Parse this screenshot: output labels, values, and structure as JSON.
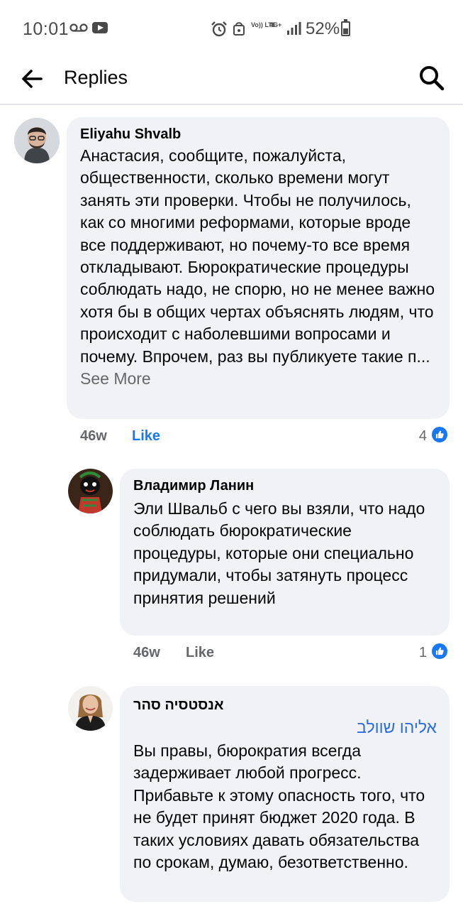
{
  "status_bar": {
    "time": "10:01",
    "battery": "52%",
    "network_volte": "Vo)) LTE",
    "network_4g": "4G+"
  },
  "header": {
    "title": "Replies",
    "back_icon": "back-arrow-icon",
    "search_icon": "search-icon"
  },
  "colors": {
    "bubble": "#f0f2f5",
    "like_blue": "#1877f2",
    "meta_gray": "#65676b"
  },
  "comments": [
    {
      "author": "Eliyahu Shvalb",
      "text": "Анастасия, сообщите, пожалуйста, общественности, сколько времени могут занять эти проверки. Чтобы не получилось, как со многими реформами, которые вроде все поддерживают, но почему-то все время откладывают. Бюрократические процедуры соблюдать надо, не спорю, но не менее важно хотя бы в общих чертах объяснять людям, что происходит с наболевшими вопросами и почему. Впрочем, раз вы публикуете такие п...",
      "see_more": "See More",
      "time": "46w",
      "like_label": "Like",
      "like_count": "4"
    },
    {
      "author": "Владимир Ланин",
      "text": "Эли Швальб  с чего вы взяли, что надо соблюдать бюрократические процедуры, которые они специально придумали, чтобы затянуть процесс принятия решений",
      "time": "46w",
      "like_label": "Like",
      "like_count": "1"
    },
    {
      "author": "אנסטסיה סהר",
      "mention": "אליהו שוולב",
      "text": "Вы правы, бюрократия всегда задерживает любой прогресс. Прибавьте к этому опасность того, что не будет принят бюджет 2020 года. В таких условиях давать обязательства по срокам, думаю, безответственно."
    }
  ]
}
